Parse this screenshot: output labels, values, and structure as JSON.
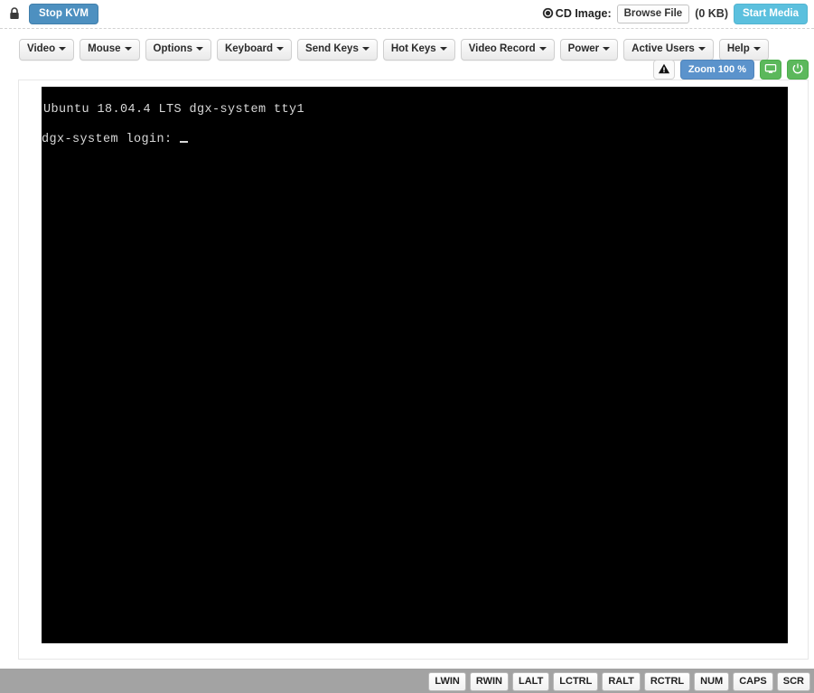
{
  "topbar": {
    "lock_icon": "lock-icon",
    "stop_kvm_label": "Stop KVM",
    "cd_icon": "cd-disc-icon",
    "cd_image_label": "CD Image:",
    "browse_file_label": "Browse File",
    "media_size": "(0 KB)",
    "start_media_label": "Start Media",
    "colors": {
      "stop_kvm_bg": "#4d90c0",
      "start_media_bg": "#5bc0de"
    }
  },
  "menubar": {
    "items": [
      {
        "label": "Video",
        "caret": true
      },
      {
        "label": "Mouse",
        "caret": true
      },
      {
        "label": "Options",
        "caret": true
      },
      {
        "label": "Keyboard",
        "caret": true
      },
      {
        "label": "Send Keys",
        "caret": true
      },
      {
        "label": "Hot Keys",
        "caret": true
      },
      {
        "label": "Video Record",
        "caret": true
      },
      {
        "label": "Power",
        "caret": true
      },
      {
        "label": "Active Users",
        "caret": true
      },
      {
        "label": "Help",
        "caret": true
      }
    ]
  },
  "controlrow": {
    "warning_icon": "warning-triangle-icon",
    "zoom_label": "Zoom 100 %",
    "display_icon": "monitor-icon",
    "power_icon": "power-icon",
    "colors": {
      "zoom_bg": "#5b93cc",
      "green_bg": "#5cb85c"
    }
  },
  "console": {
    "line1": "Ubuntu 18.04.4 LTS dgx-system tty1",
    "line2": "dgx-system login: ",
    "cursor": "_",
    "background": "#000000",
    "foreground": "#d8d8d8"
  },
  "footer": {
    "bar_color": "#a3a3a3",
    "keys": [
      "LWIN",
      "RWIN",
      "LALT",
      "LCTRL",
      "RALT",
      "RCTRL",
      "NUM",
      "CAPS",
      "SCR"
    ]
  }
}
